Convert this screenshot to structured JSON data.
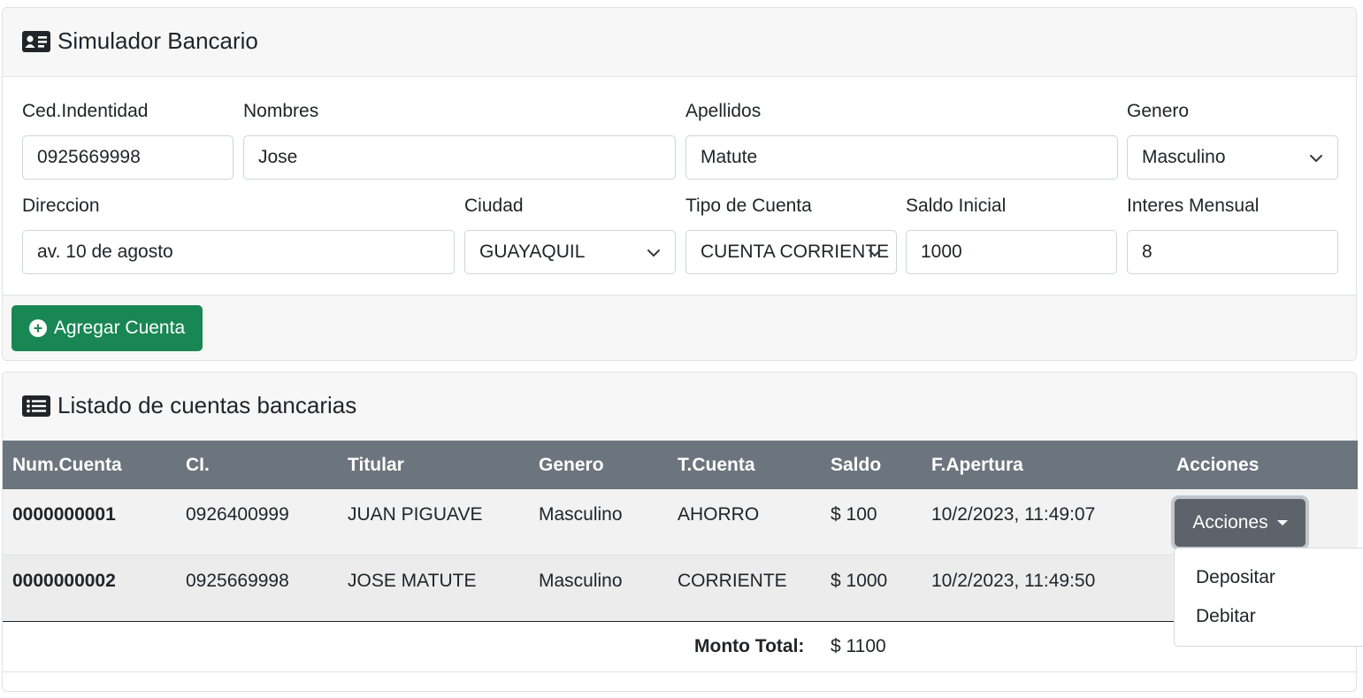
{
  "form_card": {
    "title": "Simulador Bancario",
    "fields": {
      "cedula": {
        "label": "Ced.Indentidad",
        "value": "0925669998"
      },
      "nombres": {
        "label": "Nombres",
        "value": "Jose"
      },
      "apellidos": {
        "label": "Apellidos",
        "value": "Matute"
      },
      "genero": {
        "label": "Genero",
        "value": "Masculino"
      },
      "direccion": {
        "label": "Direccion",
        "value": "av. 10 de agosto"
      },
      "ciudad": {
        "label": "Ciudad",
        "value": "GUAYAQUIL"
      },
      "tipo_cuenta": {
        "label": "Tipo de Cuenta",
        "value": "CUENTA CORRIENTE"
      },
      "saldo_inicial": {
        "label": "Saldo Inicial",
        "value": "1000"
      },
      "interes_mensual": {
        "label": "Interes Mensual",
        "value": "8"
      }
    },
    "add_button": "Agregar Cuenta"
  },
  "list_card": {
    "title": "Listado de cuentas bancarias",
    "columns": [
      "Num.Cuenta",
      "CI.",
      "Titular",
      "Genero",
      "T.Cuenta",
      "Saldo",
      "F.Apertura",
      "Acciones"
    ],
    "rows": [
      [
        "0000000001",
        "0926400999",
        "JUAN PIGUAVE",
        "Masculino",
        "AHORRO",
        "$ 100",
        "10/2/2023, 11:49:07"
      ],
      [
        "0000000002",
        "0925669998",
        "JOSE MATUTE",
        "Masculino",
        "CORRIENTE",
        "$ 1000",
        "10/2/2023, 11:49:50"
      ]
    ],
    "actions_button": "Acciones",
    "actions_menu": [
      "Depositar",
      "Debitar"
    ],
    "total_label": "Monto Total:",
    "total_value": "$ 1100"
  },
  "colors": {
    "success": "#198754",
    "table_header": "#6c757d",
    "secondary_button": "#5c636a"
  }
}
